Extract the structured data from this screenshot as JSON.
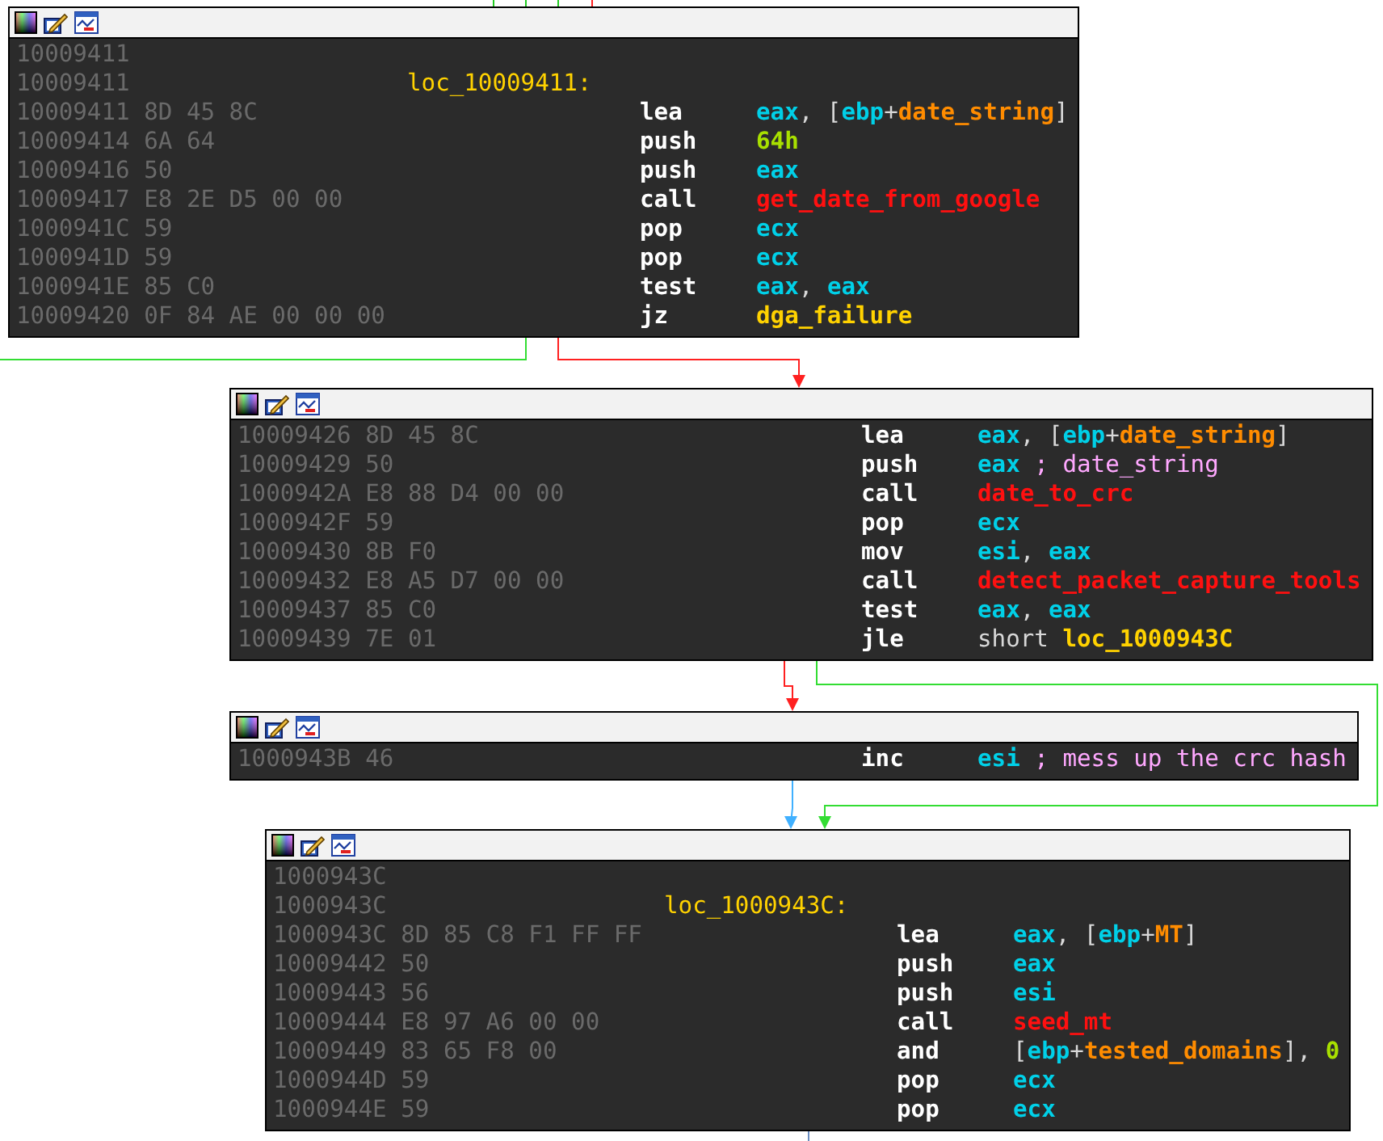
{
  "blocks": [
    {
      "lines": [
        {
          "address": "10009411"
        },
        {
          "address": "10009411",
          "label": "loc_10009411:"
        },
        {
          "address": "10009411",
          "bytes": "8D 45 8C",
          "mnemonic": "lea",
          "operands": [
            {
              "kind": "reg",
              "text": "eax"
            },
            {
              "kind": "punct",
              "text": ", ["
            },
            {
              "kind": "reg",
              "text": "ebp"
            },
            {
              "kind": "punct",
              "text": "+"
            },
            {
              "kind": "var",
              "text": "date_string"
            },
            {
              "kind": "punct",
              "text": "]"
            }
          ]
        },
        {
          "address": "10009414",
          "bytes": "6A 64",
          "mnemonic": "push",
          "operands": [
            {
              "kind": "imm",
              "text": "64h"
            }
          ]
        },
        {
          "address": "10009416",
          "bytes": "50",
          "mnemonic": "push",
          "operands": [
            {
              "kind": "reg",
              "text": "eax"
            }
          ]
        },
        {
          "address": "10009417",
          "bytes": "E8 2E D5 00 00",
          "mnemonic": "call",
          "operands": [
            {
              "kind": "func",
              "text": "get_date_from_google"
            }
          ]
        },
        {
          "address": "1000941C",
          "bytes": "59",
          "mnemonic": "pop",
          "operands": [
            {
              "kind": "reg",
              "text": "ecx"
            }
          ]
        },
        {
          "address": "1000941D",
          "bytes": "59",
          "mnemonic": "pop",
          "operands": [
            {
              "kind": "reg",
              "text": "ecx"
            }
          ]
        },
        {
          "address": "1000941E",
          "bytes": "85 C0",
          "mnemonic": "test",
          "operands": [
            {
              "kind": "reg",
              "text": "eax"
            },
            {
              "kind": "punct",
              "text": ", "
            },
            {
              "kind": "reg",
              "text": "eax"
            }
          ]
        },
        {
          "address": "10009420",
          "bytes": "0F 84 AE 00 00 00",
          "mnemonic": "jz",
          "operands": [
            {
              "kind": "label",
              "text": "dga_failure"
            }
          ]
        }
      ]
    },
    {
      "lines": [
        {
          "address": "10009426",
          "bytes": "8D 45 8C",
          "mnemonic": "lea",
          "operands": [
            {
              "kind": "reg",
              "text": "eax"
            },
            {
              "kind": "punct",
              "text": ", ["
            },
            {
              "kind": "reg",
              "text": "ebp"
            },
            {
              "kind": "punct",
              "text": "+"
            },
            {
              "kind": "var",
              "text": "date_string"
            },
            {
              "kind": "punct",
              "text": "]"
            }
          ]
        },
        {
          "address": "10009429",
          "bytes": "50",
          "mnemonic": "push",
          "operands": [
            {
              "kind": "reg",
              "text": "eax"
            },
            {
              "kind": "comment",
              "text": " ; date_string"
            }
          ]
        },
        {
          "address": "1000942A",
          "bytes": "E8 88 D4 00 00",
          "mnemonic": "call",
          "operands": [
            {
              "kind": "func",
              "text": "date_to_crc"
            }
          ]
        },
        {
          "address": "1000942F",
          "bytes": "59",
          "mnemonic": "pop",
          "operands": [
            {
              "kind": "reg",
              "text": "ecx"
            }
          ]
        },
        {
          "address": "10009430",
          "bytes": "8B F0",
          "mnemonic": "mov",
          "operands": [
            {
              "kind": "reg",
              "text": "esi"
            },
            {
              "kind": "punct",
              "text": ", "
            },
            {
              "kind": "reg",
              "text": "eax"
            }
          ]
        },
        {
          "address": "10009432",
          "bytes": "E8 A5 D7 00 00",
          "mnemonic": "call",
          "operands": [
            {
              "kind": "func",
              "text": "detect_packet_capture_tools"
            }
          ]
        },
        {
          "address": "10009437",
          "bytes": "85 C0",
          "mnemonic": "test",
          "operands": [
            {
              "kind": "reg",
              "text": "eax"
            },
            {
              "kind": "punct",
              "text": ", "
            },
            {
              "kind": "reg",
              "text": "eax"
            }
          ]
        },
        {
          "address": "10009439",
          "bytes": "7E 01",
          "mnemonic": "jle",
          "operands": [
            {
              "kind": "punct",
              "text": "short "
            },
            {
              "kind": "label",
              "text": "loc_1000943C"
            }
          ]
        }
      ]
    },
    {
      "lines": [
        {
          "address": "1000943B",
          "bytes": "46",
          "mnemonic": "inc",
          "operands": [
            {
              "kind": "reg",
              "text": "esi"
            },
            {
              "kind": "comment",
              "text": " ; mess up the crc hash"
            }
          ]
        }
      ]
    },
    {
      "lines": [
        {
          "address": "1000943C"
        },
        {
          "address": "1000943C",
          "label": "loc_1000943C:"
        },
        {
          "address": "1000943C",
          "bytes": "8D 85 C8 F1 FF FF",
          "mnemonic": "lea",
          "operands": [
            {
              "kind": "reg",
              "text": "eax"
            },
            {
              "kind": "punct",
              "text": ", ["
            },
            {
              "kind": "reg",
              "text": "ebp"
            },
            {
              "kind": "punct",
              "text": "+"
            },
            {
              "kind": "var",
              "text": "MT"
            },
            {
              "kind": "punct",
              "text": "]"
            }
          ]
        },
        {
          "address": "10009442",
          "bytes": "50",
          "mnemonic": "push",
          "operands": [
            {
              "kind": "reg",
              "text": "eax"
            }
          ]
        },
        {
          "address": "10009443",
          "bytes": "56",
          "mnemonic": "push",
          "operands": [
            {
              "kind": "reg",
              "text": "esi"
            }
          ]
        },
        {
          "address": "10009444",
          "bytes": "E8 97 A6 00 00",
          "mnemonic": "call",
          "operands": [
            {
              "kind": "func",
              "text": "seed_mt"
            }
          ]
        },
        {
          "address": "10009449",
          "bytes": "83 65 F8 00",
          "mnemonic": "and",
          "operands": [
            {
              "kind": "punct",
              "text": "["
            },
            {
              "kind": "reg",
              "text": "ebp"
            },
            {
              "kind": "punct",
              "text": "+"
            },
            {
              "kind": "var",
              "text": "tested_domains"
            },
            {
              "kind": "punct",
              "text": "], "
            },
            {
              "kind": "imm",
              "text": "0"
            }
          ]
        },
        {
          "address": "1000944D",
          "bytes": "59",
          "mnemonic": "pop",
          "operands": [
            {
              "kind": "reg",
              "text": "ecx"
            }
          ]
        },
        {
          "address": "1000944E",
          "bytes": "59",
          "mnemonic": "pop",
          "operands": [
            {
              "kind": "reg",
              "text": "ecx"
            }
          ]
        }
      ]
    }
  ]
}
